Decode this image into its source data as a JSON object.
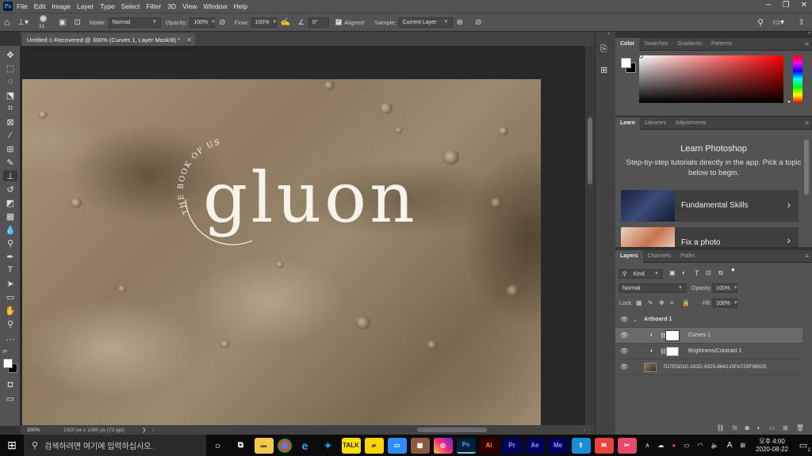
{
  "menubar": {
    "app_logo": "Ps",
    "items": [
      "File",
      "Edit",
      "Image",
      "Layer",
      "Type",
      "Select",
      "Filter",
      "3D",
      "View",
      "Window",
      "Help"
    ]
  },
  "options": {
    "brush_size": "21",
    "mode_label": "Mode:",
    "mode_value": "Normal",
    "opacity_label": "Opacity:",
    "opacity_value": "100%",
    "flow_label": "Flow:",
    "flow_value": "100%",
    "angle_value": "0°",
    "aligned_label": "Aligned",
    "sample_label": "Sample:",
    "sample_value": "Current Layer"
  },
  "document": {
    "tab_title": "Untitled-1-Recovered @ 300% (Curves 1, Layer Mask/8) *",
    "artwork_word": "gluon",
    "artwork_arc_text": "THE BOOK OF US",
    "zoom": "300%",
    "doc_info": "1920 px x 1080 px (72 ppi)"
  },
  "color_panel": {
    "tabs": [
      "Color",
      "Swatches",
      "Gradients",
      "Patterns"
    ],
    "active_tab": "Color",
    "foreground": "#ffffff",
    "background": "#000000",
    "hue_color": "#ff0000"
  },
  "learn_panel": {
    "tabs": [
      "Learn",
      "Libraries",
      "Adjustments"
    ],
    "title": "Learn Photoshop",
    "description": "Step-by-step tutorials directly in the app. Pick a topic below to begin.",
    "cards": [
      {
        "label": "Fundamental Skills"
      },
      {
        "label": "Fix a photo"
      }
    ]
  },
  "layers_panel": {
    "tabs": [
      "Layers",
      "Channels",
      "Paths"
    ],
    "kind_label": "Kind",
    "blend_mode": "Normal",
    "opacity_label": "Opacity:",
    "opacity_value": "100%",
    "lock_label": "Lock:",
    "fill_label": "Fill:",
    "fill_value": "100%",
    "layers": [
      {
        "name": "Artboard 1",
        "type": "group"
      },
      {
        "name": "Curves 1",
        "type": "adjustment",
        "selected": true
      },
      {
        "name": "Brightness/Contrast 1",
        "type": "adjustment"
      },
      {
        "name": "7D7E5D10-331D-4325-8642-DFA725F96025",
        "type": "image"
      }
    ]
  },
  "taskbar": {
    "search_placeholder": "검색하려면 여기에 입력하십시오.",
    "apps": [
      "explorer",
      "chrome",
      "edge",
      "twitter",
      "kakaotalk",
      "sticky-notes",
      "zoom",
      "photo-app",
      "app",
      "Ps",
      "Ai",
      "Pr",
      "Ae",
      "Me",
      "app2",
      "app3",
      "app4"
    ],
    "clock_time": "오후 4:00",
    "clock_date": "2020-08-22",
    "ime_label": "A",
    "notification_count": "2"
  }
}
